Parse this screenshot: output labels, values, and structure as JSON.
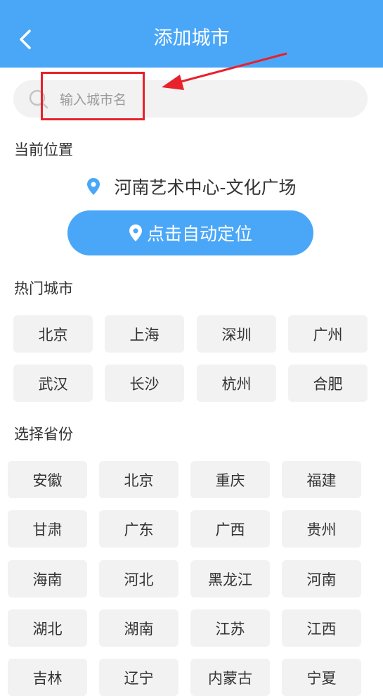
{
  "header": {
    "title": "添加城市"
  },
  "search": {
    "placeholder": "输入城市名"
  },
  "current_location": {
    "label": "当前位置",
    "place": "河南艺术中心-文化广场",
    "auto_locate_label": "点击自动定位"
  },
  "hot_cities": {
    "label": "热门城市",
    "items": [
      "北京",
      "上海",
      "深圳",
      "广州",
      "武汉",
      "长沙",
      "杭州",
      "合肥"
    ]
  },
  "provinces": {
    "label": "选择省份",
    "items": [
      "安徽",
      "北京",
      "重庆",
      "福建",
      "甘肃",
      "广东",
      "广西",
      "贵州",
      "海南",
      "河北",
      "黑龙江",
      "河南",
      "湖北",
      "湖南",
      "江苏",
      "江西",
      "吉林",
      "辽宁",
      "内蒙古",
      "宁夏"
    ]
  },
  "colors": {
    "accent": "#4aa7f8",
    "annotation": "#e8212a",
    "chip_bg": "#f2f2f2"
  }
}
